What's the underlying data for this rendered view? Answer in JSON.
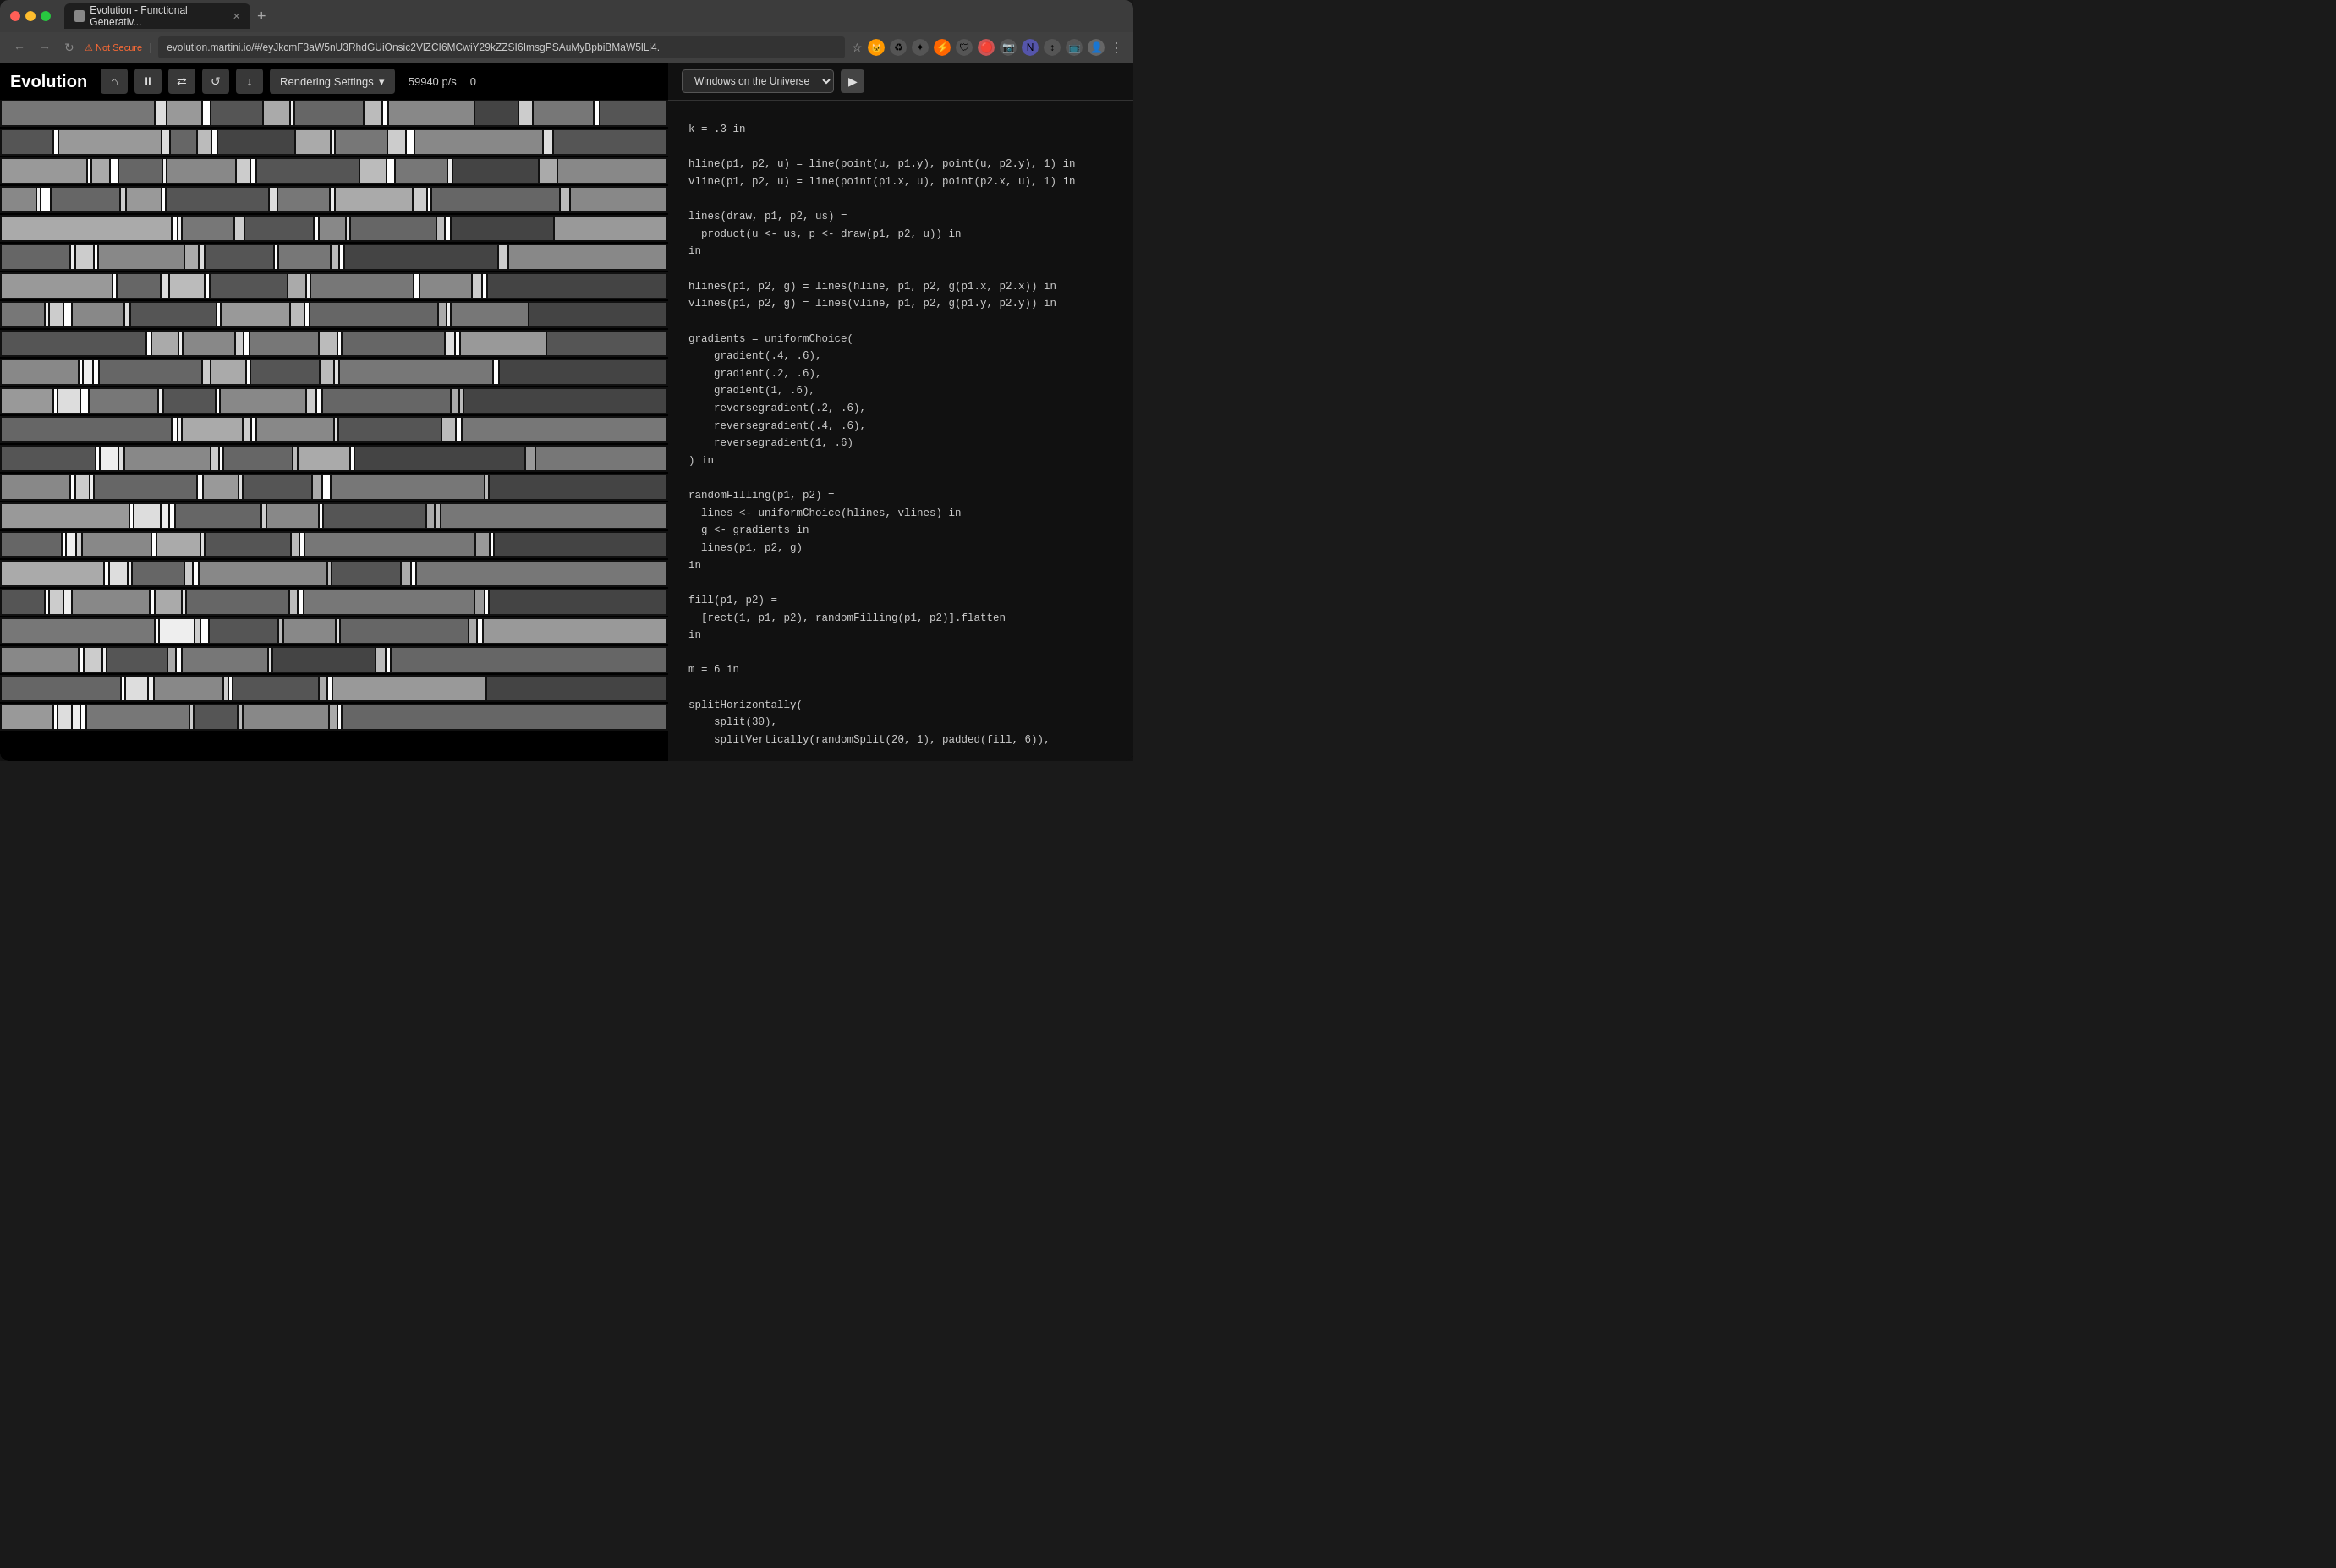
{
  "browser": {
    "tab_title": "Evolution - Functional Generativ...",
    "new_tab_label": "+",
    "nav_back": "←",
    "nav_forward": "→",
    "nav_refresh": "↻",
    "security_warning": "Not Secure",
    "url": "evolution.martini.io/#/eyJkcmF3aW5nU3RhdGUiOnsic2VlZCI6MCwiY29kZZSI6ImsgPSAuMyBpbiBMaW5lLi4.",
    "star_icon": "☆"
  },
  "toolbar": {
    "title": "Evolution",
    "pause_label": "⏸",
    "shuffle_label": "⇄",
    "refresh_label": "↺",
    "download_label": "↓",
    "rendering_settings_label": "Rendering Settings",
    "fps_value": "59940 p/s",
    "fps_right": "0"
  },
  "code_panel": {
    "window_title": "Windows on the Universe",
    "arrow_right": "▶",
    "code": "k = .3 in\n\nhline(p1, p2, u) = line(point(u, p1.y), point(u, p2.y), 1) in\nvline(p1, p2, u) = line(point(p1.x, u), point(p2.x, u), 1) in\n\nlines(draw, p1, p2, us) =\n  product(u <- us, p <- draw(p1, p2, u)) in\nin\n\nhlines(p1, p2, g) = lines(hline, p1, p2, g(p1.x, p2.x)) in\nvlines(p1, p2, g) = lines(vline, p1, p2, g(p1.y, p2.y)) in\n\ngradients = uniformChoice(\n    gradient(.4, .6),\n    gradient(.2, .6),\n    gradient(1, .6),\n    reversegradient(.2, .6),\n    reversegradient(.4, .6),\n    reversegradient(1, .6)\n) in\n\nrandomFilling(p1, p2) =\n  lines <- uniformChoice(hlines, vlines) in\n  g <- gradients in\n  lines(p1, p2, g)\nin\n\nfill(p1, p2) =\n  [rect(1, p1, p2), randomFilling(p1, p2)].flatten\nin\n\nm = 6 in\n\nsplitHorizontally(\n    split(30),\n    splitVertically(randomSplit(20, 1), padded(fill, 6)),"
  }
}
